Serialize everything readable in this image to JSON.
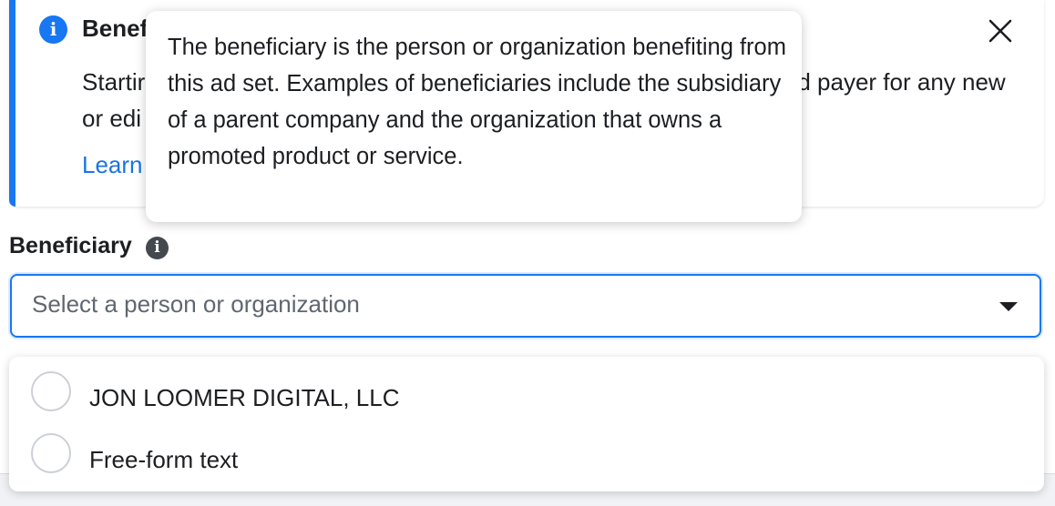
{
  "banner": {
    "title": "Benef",
    "text": "Startir                                                                                          d payer for any new or edi",
    "link": "Learn"
  },
  "tooltip": {
    "text": "The beneficiary is the person or organization benefiting from this ad set. Examples of beneficiaries include the subsidiary of a parent company and the organization that owns a promoted product or service."
  },
  "field": {
    "label": "Beneficiary",
    "placeholder": "Select a person or organization"
  },
  "dropdown": {
    "options": [
      {
        "label": "JON LOOMER DIGITAL, LLC"
      },
      {
        "label": "Free-form text"
      }
    ]
  },
  "colors": {
    "accent": "#1877f2",
    "link": "#1b74e4",
    "text": "#1c1e21",
    "placeholder": "#606770"
  },
  "icons": {
    "banner_info": "info-icon",
    "close": "close-icon",
    "label_info": "info-icon",
    "caret": "caret-down-icon"
  }
}
